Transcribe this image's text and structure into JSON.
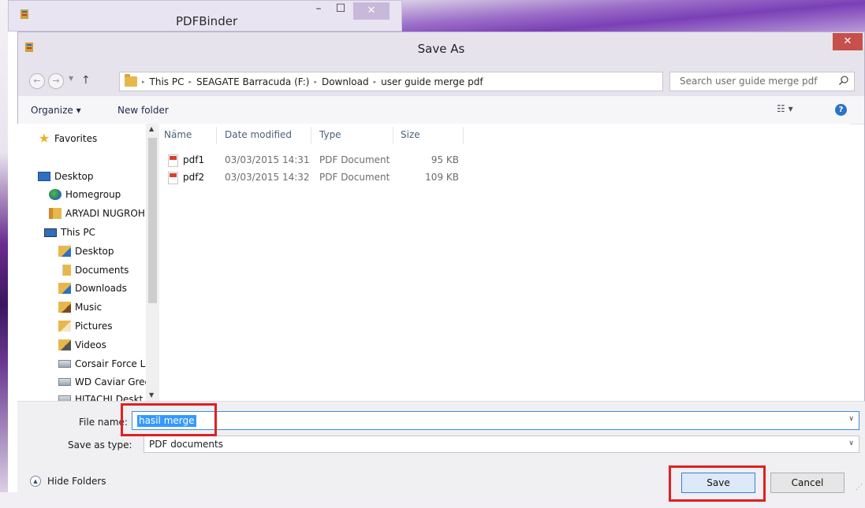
{
  "background_app": {
    "title": "PDFBinder",
    "minimize_label": "–",
    "maximize_label": "☐",
    "close_label": "✕"
  },
  "dialog": {
    "title": "Save As",
    "close_label": "✕"
  },
  "address_bar": {
    "back_label": "←",
    "forward_label": "→",
    "up_label": "↑",
    "breadcrumbs": [
      "This PC",
      "SEAGATE Barracuda (F:)",
      "Download",
      "user guide merge pdf"
    ],
    "separator": "▸"
  },
  "search": {
    "placeholder": "Search user guide merge pdf"
  },
  "toolbar": {
    "organize_label": "Organize ▾",
    "new_folder_label": "New folder",
    "view_label": "☷ ▾",
    "help_label": "?"
  },
  "nav_pane": {
    "items": [
      {
        "label": "Favorites",
        "icon": "star-icon"
      },
      {
        "label": "Desktop",
        "icon": "desktop-icon"
      },
      {
        "label": "Homegroup",
        "icon": "homegroup-icon"
      },
      {
        "label": "ARYADI NUGROH",
        "icon": "user-folder-icon"
      },
      {
        "label": "This PC",
        "icon": "computer-icon"
      },
      {
        "label": "Desktop",
        "icon": "folder-icon"
      },
      {
        "label": "Documents",
        "icon": "documents-folder-icon"
      },
      {
        "label": "Downloads",
        "icon": "downloads-folder-icon"
      },
      {
        "label": "Music",
        "icon": "music-folder-icon"
      },
      {
        "label": "Pictures",
        "icon": "pictures-folder-icon"
      },
      {
        "label": "Videos",
        "icon": "videos-folder-icon"
      },
      {
        "label": "Corsair Force L",
        "icon": "drive-icon"
      },
      {
        "label": "WD Caviar Gree",
        "icon": "drive-icon"
      },
      {
        "label": "HITACHI Deskt",
        "icon": "drive-icon"
      }
    ]
  },
  "file_list": {
    "columns": [
      "Name",
      "Date modified",
      "Type",
      "Size"
    ],
    "rows": [
      {
        "name": "pdf1",
        "date": "03/03/2015 14:31",
        "type": "PDF Document",
        "size": "95 KB"
      },
      {
        "name": "pdf2",
        "date": "03/03/2015 14:32",
        "type": "PDF Document",
        "size": "109 KB"
      }
    ]
  },
  "form": {
    "file_name_label": "File name:",
    "file_name_value": "hasil merge",
    "save_type_label": "Save as type:",
    "save_type_value": "PDF documents"
  },
  "footer": {
    "hide_folders_label": "Hide Folders",
    "save_label": "Save",
    "cancel_label": "Cancel"
  },
  "colors": {
    "annotation": "#e02020",
    "selection": "#3399ff",
    "accent": "#3c8de0"
  }
}
